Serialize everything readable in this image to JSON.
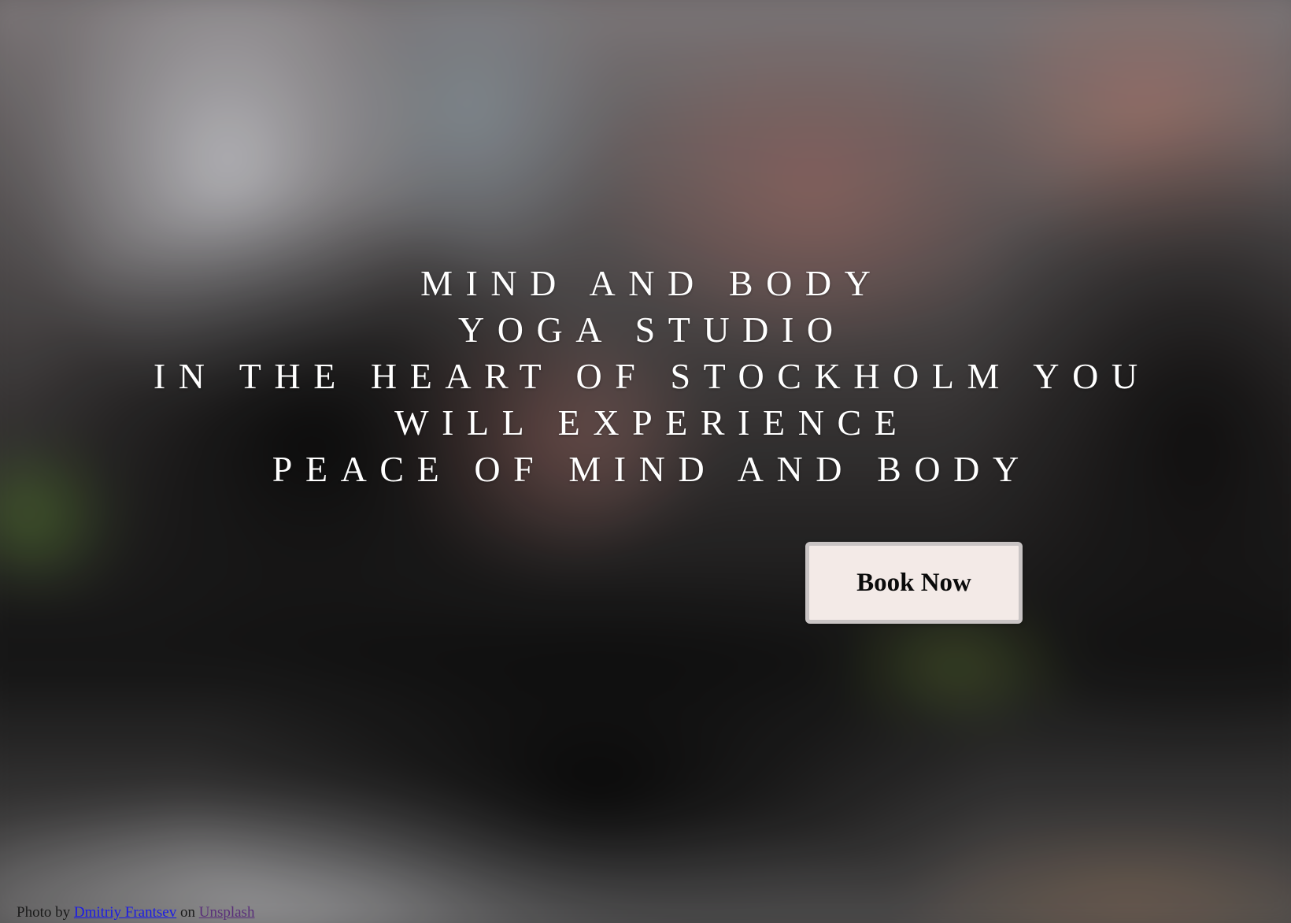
{
  "hero": {
    "headline_lines": [
      "MIND AND BODY",
      "YOGA STUDIO",
      "IN THE HEART OF STOCKHOLM YOU",
      "WILL EXPERIENCE",
      "PEACE OF MIND AND BODY"
    ],
    "cta_label": "Book Now"
  },
  "credit": {
    "prefix": "Photo by",
    "author": "Dmitriy Frantsev",
    "middle": "on",
    "site": "Unsplash"
  },
  "colors": {
    "headline_text": "#ffffff",
    "button_bg": "#f3eae7",
    "button_border": "#c9c4c4",
    "link": "#1a1ae6",
    "visited_link": "#5a2f7a"
  }
}
